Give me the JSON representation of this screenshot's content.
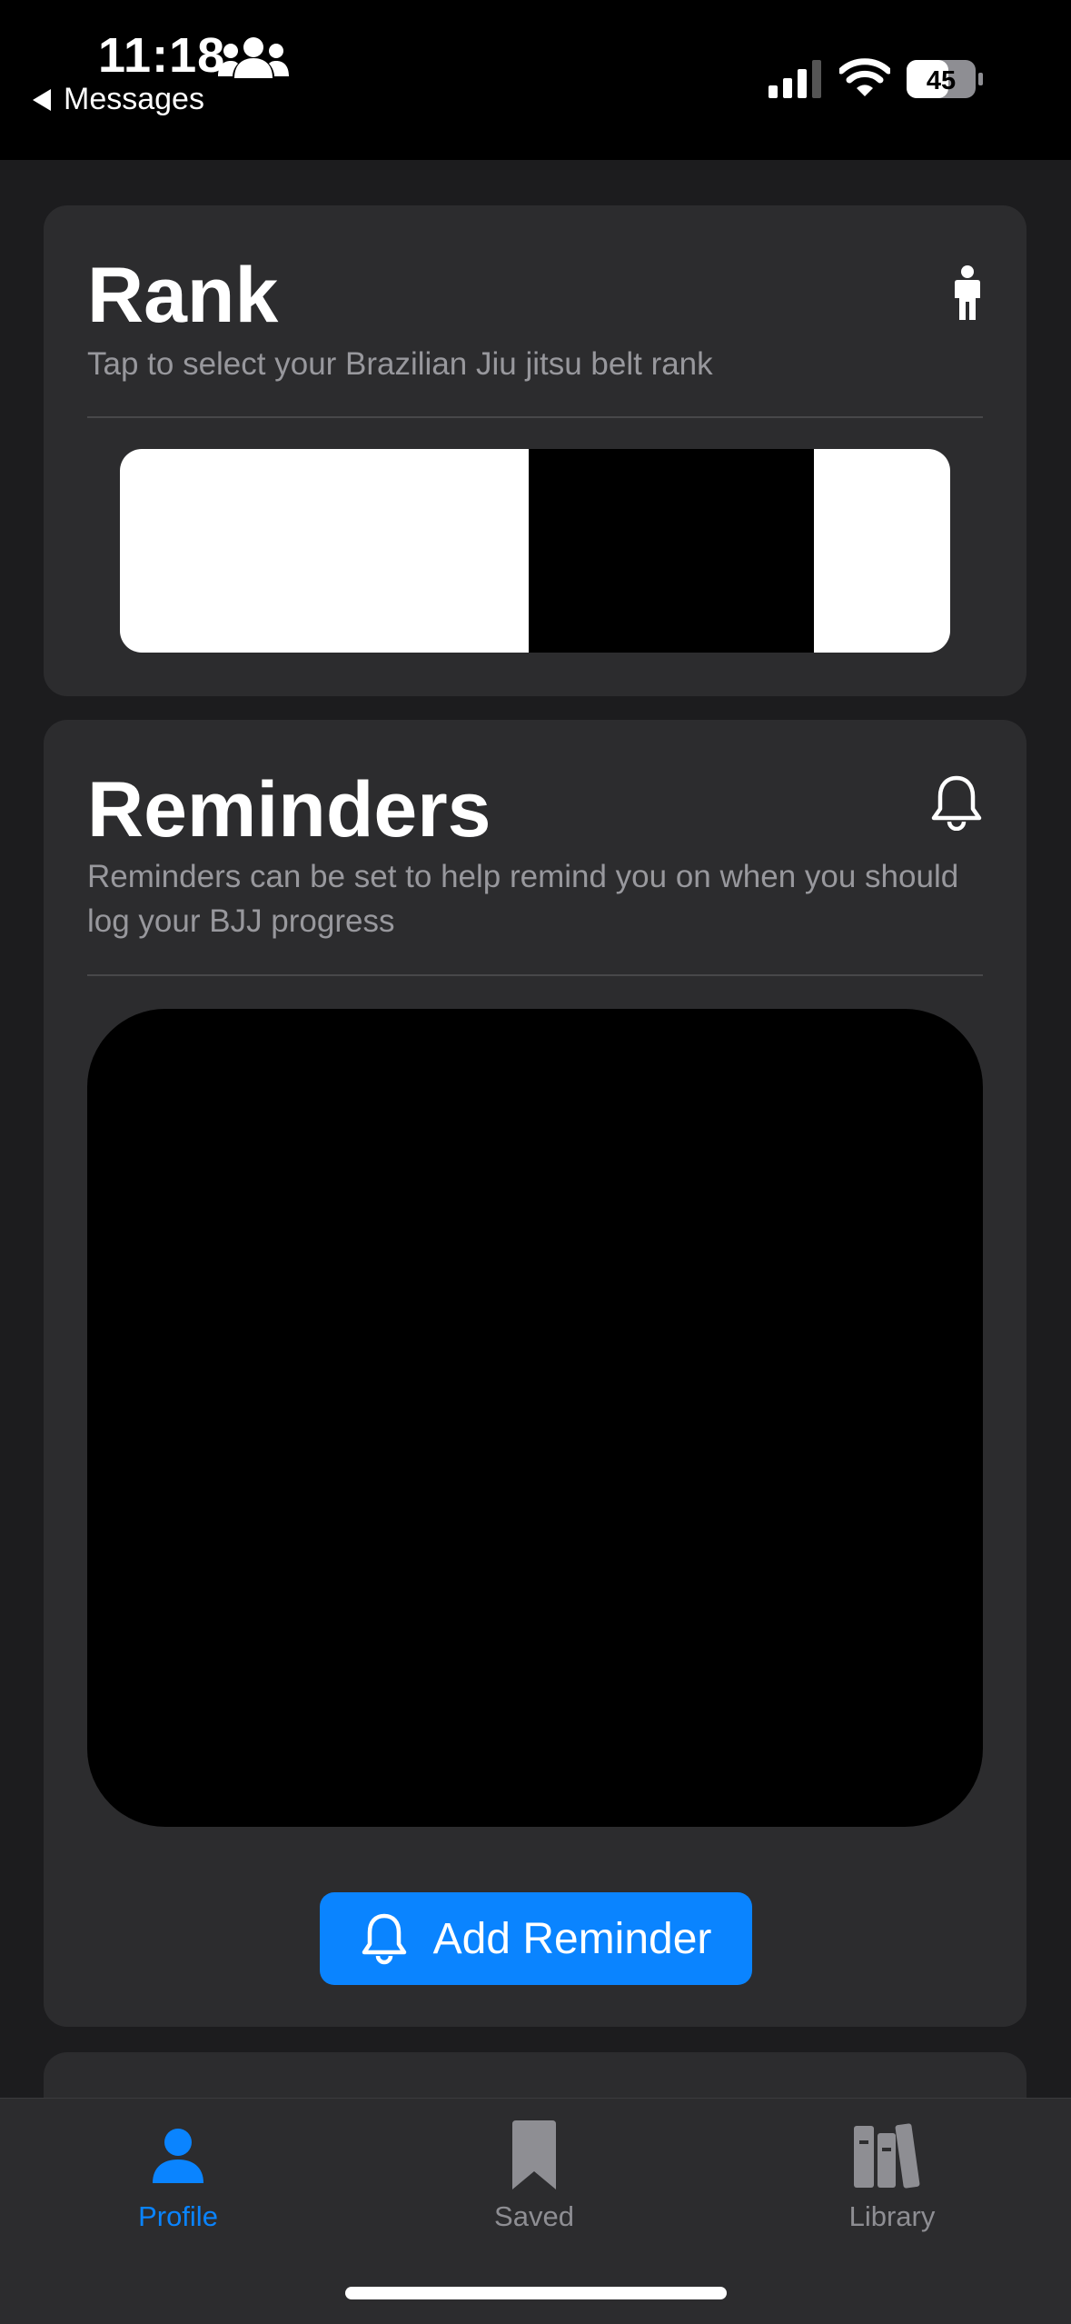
{
  "status_bar": {
    "time": "11:18",
    "back_label": "Messages",
    "battery": "45"
  },
  "rank": {
    "title": "Rank",
    "subtitle": "Tap to select your Brazilian Jiu jitsu belt rank",
    "icon": "person-icon",
    "belt_colors": {
      "base": "#ffffff",
      "bar": "#000000"
    }
  },
  "reminders": {
    "title": "Reminders",
    "subtitle": "Reminders can be set to help remind you on when you should log your BJJ progress",
    "icon": "bell-icon",
    "add_button_label": "Add Reminder"
  },
  "tabbar": {
    "tabs": [
      {
        "label": "Profile",
        "icon": "person-icon",
        "active": true
      },
      {
        "label": "Saved",
        "icon": "bookmark-icon",
        "active": false
      },
      {
        "label": "Library",
        "icon": "books-icon",
        "active": false
      }
    ]
  },
  "colors": {
    "accent": "#0a84ff",
    "card": "#2c2c2e",
    "background": "#1c1c1e",
    "secondary_text": "#98989d"
  }
}
